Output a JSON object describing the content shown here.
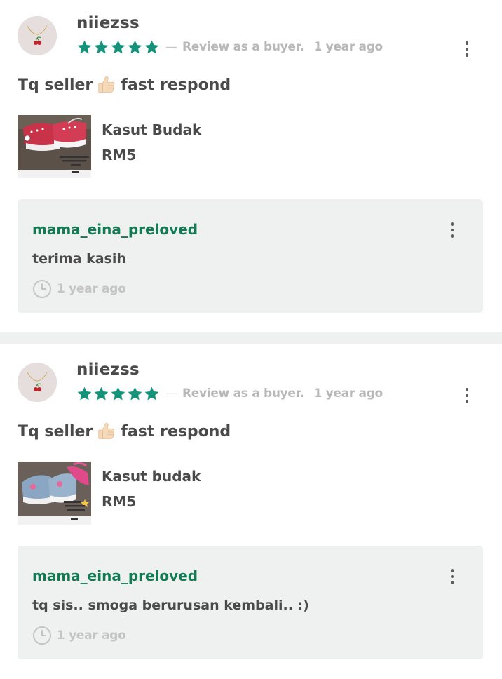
{
  "colors": {
    "star": "#15937a",
    "reply_username": "#137a55",
    "muted_text": "#b8b8b8",
    "reply_background": "#eff0f0",
    "separator": "#eff0f0"
  },
  "icons": {
    "star": "star-icon",
    "more": "more-vertical-icon",
    "clock": "clock-icon",
    "thumbs_up": "thumbs-up-emoji"
  },
  "reviews": [
    {
      "username": "niiezss",
      "rating": 5,
      "review_role": "Review as a buyer.",
      "dash": "—",
      "time": "1 year ago",
      "text_before": "Tq seller",
      "text_after": "fast respond",
      "product": {
        "name": "Kasut Budak",
        "price": "RM5"
      },
      "reply": {
        "username": "mama_eina_preloved",
        "text": "terima kasih",
        "time": "1 year ago"
      }
    },
    {
      "username": "niiezss",
      "rating": 5,
      "review_role": "Review as a buyer.",
      "dash": "—",
      "time": "1 year ago",
      "text_before": "Tq seller",
      "text_after": "fast respond",
      "product": {
        "name": "Kasut budak",
        "price": "RM5"
      },
      "reply": {
        "username": "mama_eina_preloved",
        "text": "tq sis.. smoga berurusan kembali.. :)",
        "time": "1 year ago"
      }
    }
  ]
}
